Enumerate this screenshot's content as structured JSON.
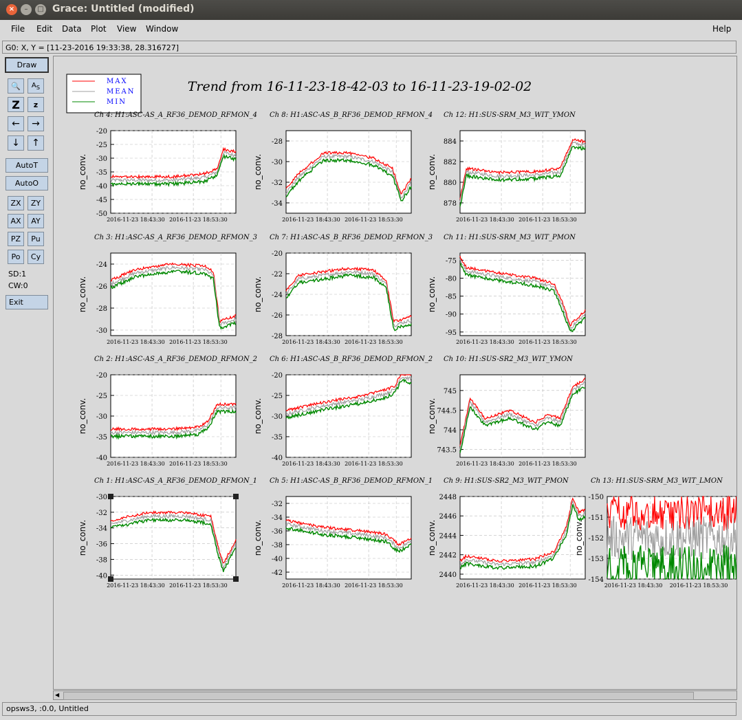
{
  "window": {
    "title": "Grace: Untitled (modified)"
  },
  "menu": {
    "file": "File",
    "edit": "Edit",
    "data": "Data",
    "plot": "Plot",
    "view": "View",
    "window": "Window",
    "help": "Help"
  },
  "locator": "G0: X, Y = [11-23-2016 19:33:38, 28.316727]",
  "toolbar": {
    "draw": "Draw",
    "zoom_icon": "magnifier-icon",
    "autot": "AutoT",
    "autoo": "AutoO",
    "zx": "ZX",
    "zy": "ZY",
    "ax": "AX",
    "ay": "AY",
    "pz": "PZ",
    "pu": "Pu",
    "po": "Po",
    "cy": "Cy",
    "sd": "SD:1",
    "cw": "CW:0",
    "exit": "Exit"
  },
  "status": "opsws3, :0.0, Untitled",
  "plot_title": "Trend from 16-11-23-18-42-03 to 16-11-23-19-02-02",
  "legend": [
    "MAX",
    "MEAN",
    "MIN"
  ],
  "colors": {
    "max": "#ff0000",
    "mean": "#a0a0a0",
    "min": "#008800",
    "legend_text": "#0000ff"
  },
  "chart_data": [
    {
      "type": "line",
      "title": "Ch 4: H1:ASC-AS_A_RF36_DEMOD_RFMON_4",
      "ylabel": "no_conv.",
      "ylim": [
        -50,
        -20
      ],
      "yticks": [
        "-20",
        "-25",
        "-30",
        "-35",
        "-40",
        "-45",
        "-50"
      ],
      "xticks": [
        "2016-11-23 18:43:30",
        "2016-11-23 18:53:30"
      ],
      "x": [
        0,
        0.5,
        0.75,
        0.85,
        0.9,
        1
      ],
      "series": [
        {
          "name": "MEAN",
          "values": [
            -38,
            -38,
            -37,
            -35,
            -28,
            -29
          ]
        }
      ]
    },
    {
      "type": "line",
      "title": "Ch 8: H1:ASC-AS_B_RF36_DEMOD_RFMON_4",
      "ylabel": "no_conv.",
      "ylim": [
        -35,
        -27
      ],
      "yticks": [
        "-28",
        "-30",
        "-32",
        "-34"
      ],
      "xticks": [
        "2016-11-23 18:43:30",
        "2016-11-23 18:53:30"
      ],
      "x": [
        0,
        0.1,
        0.3,
        0.5,
        0.7,
        0.85,
        0.92,
        1
      ],
      "series": [
        {
          "name": "MEAN",
          "values": [
            -33,
            -31.5,
            -29.5,
            -29.5,
            -30,
            -31,
            -33.5,
            -32
          ]
        }
      ]
    },
    {
      "type": "line",
      "title": "Ch 12: H1:SUS-SRM_M3_WIT_YMON",
      "ylabel": "no_conv.",
      "ylim": [
        877,
        885
      ],
      "yticks": [
        "884",
        "882",
        "880",
        "878"
      ],
      "xticks": [
        "2016-11-23 18:43:30",
        "2016-11-23 18:53:30"
      ],
      "x": [
        0,
        0.05,
        0.3,
        0.6,
        0.8,
        0.9,
        1
      ],
      "series": [
        {
          "name": "MEAN",
          "values": [
            878,
            881,
            880.6,
            880.7,
            881,
            883.8,
            883.6
          ]
        }
      ]
    },
    {
      "type": "line",
      "title": "Ch 3: H1:ASC-AS_A_RF36_DEMOD_RFMON_3",
      "ylabel": "no_conv.",
      "ylim": [
        -30.5,
        -23
      ],
      "yticks": [
        "-24",
        "-26",
        "-28",
        "-30"
      ],
      "xticks": [
        "2016-11-23 18:43:30",
        "2016-11-23 18:53:30"
      ],
      "x": [
        0,
        0.2,
        0.5,
        0.75,
        0.82,
        0.87,
        1
      ],
      "series": [
        {
          "name": "MEAN",
          "values": [
            -25.8,
            -24.8,
            -24.3,
            -24.5,
            -25,
            -29.5,
            -29
          ]
        }
      ]
    },
    {
      "type": "line",
      "title": "Ch 7: H1:ASC-AS_B_RF36_DEMOD_RFMON_3",
      "ylabel": "no_conv.",
      "ylim": [
        -28,
        -20
      ],
      "yticks": [
        "-20",
        "-22",
        "-24",
        "-26",
        "-28"
      ],
      "xticks": [
        "2016-11-23 18:43:30",
        "2016-11-23 18:53:30"
      ],
      "x": [
        0,
        0.1,
        0.5,
        0.7,
        0.8,
        0.86,
        1
      ],
      "series": [
        {
          "name": "MEAN",
          "values": [
            -24,
            -22.5,
            -21.8,
            -22,
            -23,
            -27,
            -26.5
          ]
        }
      ]
    },
    {
      "type": "line",
      "title": "Ch 11: H1:SUS-SRM_M3_WIT_PMON",
      "ylabel": "no_conv.",
      "ylim": [
        -96,
        -73
      ],
      "yticks": [
        "-75",
        "-80",
        "-85",
        "-90",
        "-95"
      ],
      "xticks": [
        "2016-11-23 18:43:30",
        "2016-11-23 18:53:30"
      ],
      "x": [
        0,
        0.05,
        0.3,
        0.6,
        0.75,
        0.82,
        0.88,
        1
      ],
      "series": [
        {
          "name": "MEAN",
          "values": [
            -75,
            -78,
            -79.5,
            -81,
            -82.5,
            -88,
            -94,
            -90
          ]
        }
      ]
    },
    {
      "type": "line",
      "title": "Ch 2: H1:ASC-AS_A_RF36_DEMOD_RFMON_2",
      "ylabel": "no_conv.",
      "ylim": [
        -40,
        -20
      ],
      "yticks": [
        "-20",
        "-25",
        "-30",
        "-35",
        "-40"
      ],
      "xticks": [
        "2016-11-23 18:43:30",
        "2016-11-23 18:53:30"
      ],
      "x": [
        0,
        0.5,
        0.7,
        0.78,
        0.85,
        1
      ],
      "series": [
        {
          "name": "MEAN",
          "values": [
            -34,
            -34,
            -33.5,
            -32,
            -28,
            -28
          ]
        }
      ]
    },
    {
      "type": "line",
      "title": "Ch 6: H1:ASC-AS_B_RF36_DEMOD_RFMON_2",
      "ylabel": "no_conv.",
      "ylim": [
        -40,
        -20
      ],
      "yticks": [
        "-20",
        "-25",
        "-30",
        "-35",
        "-40"
      ],
      "xticks": [
        "2016-11-23 18:43:30",
        "2016-11-23 18:53:30"
      ],
      "x": [
        0,
        0.3,
        0.6,
        0.8,
        0.87,
        0.92,
        1
      ],
      "series": [
        {
          "name": "MEAN",
          "values": [
            -29.5,
            -27.5,
            -26,
            -24.5,
            -23.5,
            -20.5,
            -21
          ]
        }
      ]
    },
    {
      "type": "line",
      "title": "Ch 10: H1:SUS-SR2_M3_WIT_YMON",
      "ylabel": "no_conv.",
      "ylim": [
        743.3,
        745.4
      ],
      "yticks": [
        "745",
        "744.5",
        "744",
        "743.5"
      ],
      "xticks": [
        "2016-11-23 18:43:30",
        "2016-11-23 18:53:30"
      ],
      "x": [
        0,
        0.08,
        0.2,
        0.4,
        0.6,
        0.7,
        0.8,
        0.9,
        1
      ],
      "series": [
        {
          "name": "MEAN",
          "values": [
            743.5,
            744.7,
            744.2,
            744.4,
            744.1,
            744.3,
            744.2,
            745,
            745.2
          ]
        }
      ]
    },
    {
      "type": "line",
      "title": "Ch 1: H1:ASC-AS_A_RF36_DEMOD_RFMON_1",
      "ylabel": "no_conv.",
      "ylim": [
        -40.5,
        -30
      ],
      "yticks": [
        "-30",
        "-32",
        "-34",
        "-36",
        "-38",
        "-40"
      ],
      "xticks": [
        "2016-11-23 18:43:30",
        "2016-11-23 18:53:30"
      ],
      "x": [
        0,
        0.3,
        0.6,
        0.8,
        0.86,
        0.9,
        1
      ],
      "series": [
        {
          "name": "MEAN",
          "values": [
            -33.5,
            -32.5,
            -32.5,
            -33,
            -37,
            -39,
            -36
          ]
        }
      ]
    },
    {
      "type": "line",
      "title": "Ch 5: H1:ASC-AS_B_RF36_DEMOD_RFMON_1",
      "ylabel": "no_conv.",
      "ylim": [
        -43,
        -31
      ],
      "yticks": [
        "-32",
        "-34",
        "-36",
        "-38",
        "-40",
        "-42"
      ],
      "xticks": [
        "2016-11-23 18:43:30",
        "2016-11-23 18:53:30"
      ],
      "x": [
        0,
        0.3,
        0.6,
        0.8,
        0.9,
        1
      ],
      "series": [
        {
          "name": "MEAN",
          "values": [
            -35,
            -36,
            -36.5,
            -37,
            -38.5,
            -37.5
          ]
        }
      ]
    },
    {
      "type": "line",
      "title": "Ch 9: H1:SUS-SR2_M3_WIT_PMON",
      "ylabel": "no_conv.",
      "ylim": [
        2439.5,
        2448
      ],
      "yticks": [
        "2448",
        "2446",
        "2444",
        "2442",
        "2440"
      ],
      "xticks": [
        "2016-11-23 18:43:30",
        "2016-11-23 18:53:30"
      ],
      "x": [
        0,
        0.05,
        0.3,
        0.6,
        0.75,
        0.85,
        0.9,
        0.95,
        1
      ],
      "series": [
        {
          "name": "MEAN",
          "values": [
            2441,
            2441.5,
            2441,
            2441.2,
            2442,
            2444.5,
            2447.5,
            2446,
            2446.3
          ]
        }
      ]
    },
    {
      "type": "line",
      "title": "Ch 13: H1:SUS-SRM_M3_WIT_LMON",
      "ylabel": "no_conv.",
      "ylim": [
        -154,
        -150
      ],
      "yticks": [
        "-150",
        "-151",
        "-152",
        "-153",
        "-154"
      ],
      "xticks": [
        "2016-11-23 18:43:30",
        "2016-11-23 18:53:30"
      ],
      "x": [
        0,
        1
      ],
      "series": [
        {
          "name": "MEAN",
          "values": [
            -152,
            -152
          ]
        }
      ]
    }
  ]
}
